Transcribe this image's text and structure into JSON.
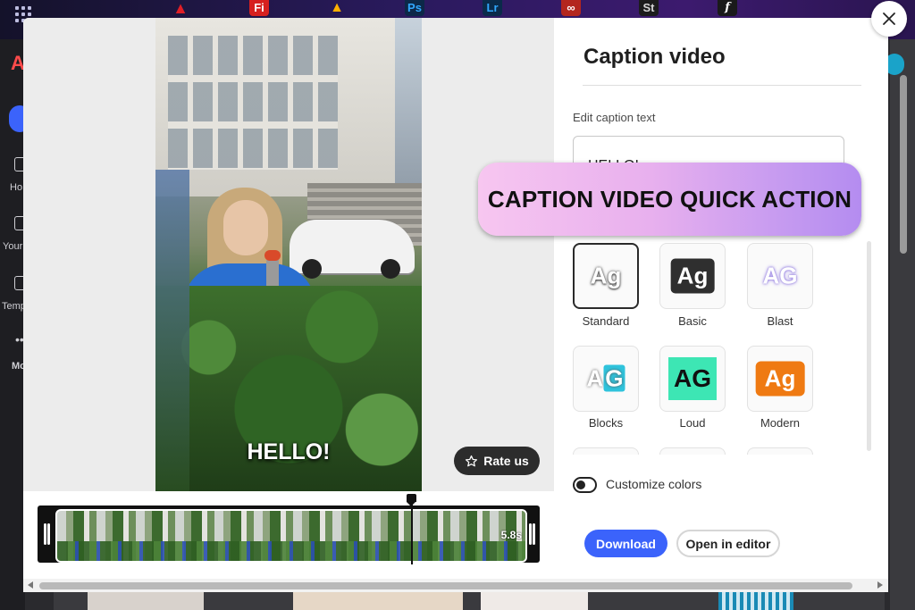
{
  "topbar": {
    "apps": [
      {
        "icon": "acrobat-icon",
        "label": "",
        "color": "#e01f26"
      },
      {
        "icon": "fresco-icon",
        "label": "Fi",
        "color": "#d6201f"
      },
      {
        "icon": "express-icon",
        "label": "",
        "color": "#2a2a2a"
      },
      {
        "icon": "photoshop-icon",
        "label": "Ps",
        "color": "#0c2848"
      },
      {
        "icon": "lightroom-icon",
        "label": "Lr",
        "color": "#0a2a4a"
      },
      {
        "icon": "acrobat-pdf-icon",
        "label": "",
        "color": "#b3261e"
      },
      {
        "icon": "stock-icon",
        "label": "St",
        "color": "#1c1c1c"
      },
      {
        "icon": "fonts-icon",
        "label": "f",
        "color": "#1a1a1a"
      }
    ]
  },
  "sidebar": {
    "items": [
      {
        "label": "Ho",
        "icon": "home-icon"
      },
      {
        "label": "Your",
        "icon": "files-icon"
      },
      {
        "label": "Temp",
        "icon": "templates-icon"
      },
      {
        "label": "Mo",
        "icon": "more-icon"
      }
    ]
  },
  "preview": {
    "caption": "HELLO!",
    "rate_label": "Rate us",
    "duration": "5.8s"
  },
  "panel": {
    "title": "Caption video",
    "caption_label": "Edit caption text",
    "caption_value": "HELLO!",
    "banner": "CAPTION VIDEO QUICK ACTION",
    "styles": [
      {
        "name": "Standard",
        "sample": "Ag",
        "selected": true
      },
      {
        "name": "Basic",
        "sample": "Ag",
        "selected": false
      },
      {
        "name": "Blast",
        "sample": "AG",
        "selected": false
      },
      {
        "name": "Blocks",
        "sample": "AG",
        "selected": false
      },
      {
        "name": "Loud",
        "sample": "AG",
        "selected": false
      },
      {
        "name": "Modern",
        "sample": "Ag",
        "selected": false
      }
    ],
    "customize_label": "Customize colors",
    "customize_on": false,
    "download_label": "Download",
    "open_editor_label": "Open in editor"
  },
  "colors": {
    "accent": "#3b63fb",
    "loud_bg": "#3de6b4",
    "modern_bg": "#ef7a12",
    "blocks_bg": "#2fc3dc"
  }
}
